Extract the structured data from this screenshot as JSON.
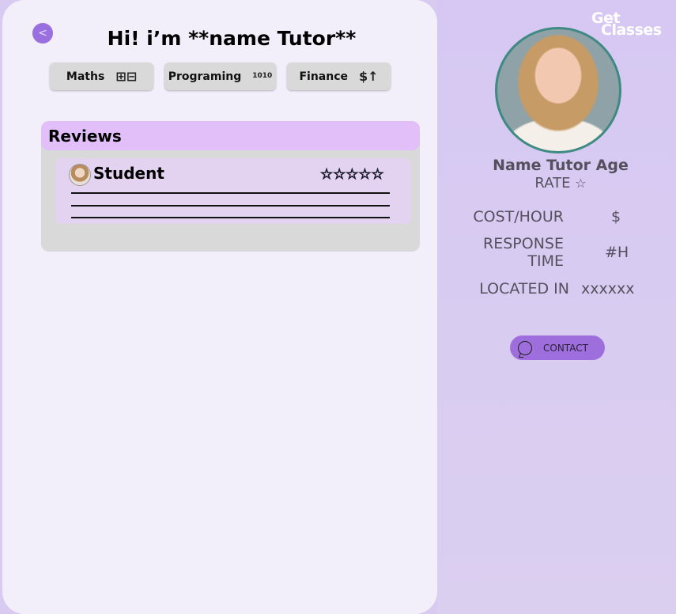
{
  "header": {
    "back_icon": "chevron-left-icon",
    "title": "Hi! i’m **name Tutor**"
  },
  "subjects": [
    {
      "label": "Maths",
      "icon": "calculator-icon",
      "glyph": "⊞⊟"
    },
    {
      "label": "Programing",
      "icon": "binary-code-icon",
      "glyph": "1010"
    },
    {
      "label": "Finance",
      "icon": "money-growth-icon",
      "glyph": "$↑"
    }
  ],
  "reviews": {
    "title": "Reviews",
    "items": [
      {
        "name": "Student",
        "stars": "☆☆☆☆☆",
        "rating": 5
      }
    ]
  },
  "brand": {
    "line1": "Get",
    "line2": "Classes"
  },
  "tutor": {
    "name": "Name Tutor Age",
    "rate_label": "RATE",
    "rate_star": "☆",
    "cost_label": "COST/HOUR",
    "cost_value": "$",
    "response_label_1": "RESPONSE",
    "response_label_2": "TIME",
    "response_value": "#H",
    "location_label": "LOCATED IN",
    "location_value": "xxxxxx",
    "contact_label": "CONTACT"
  },
  "colors": {
    "accent": "#9e6fdc",
    "reviews_header": "#e2bff9",
    "photo_ring": "#3f8a82"
  }
}
